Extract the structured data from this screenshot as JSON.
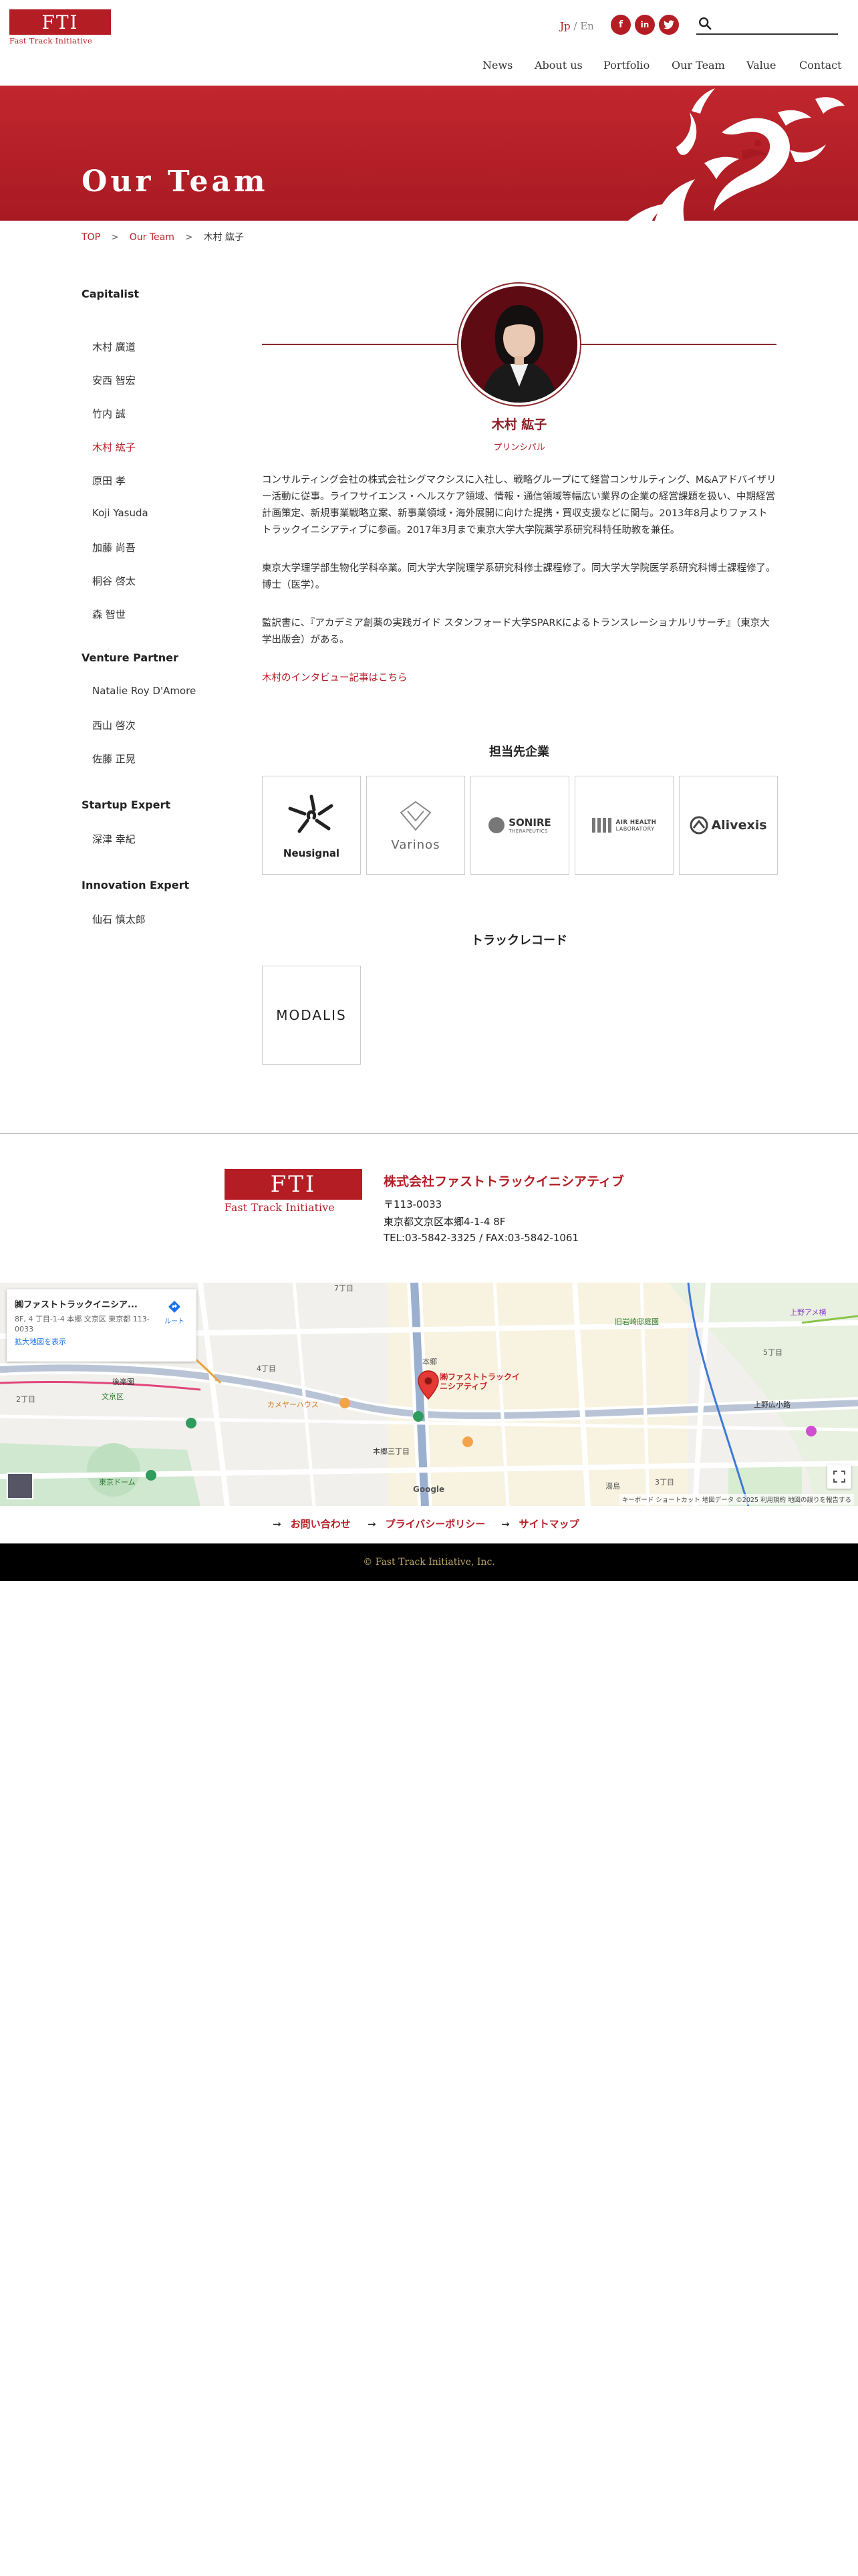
{
  "header": {
    "logo_main": "FTI",
    "logo_sub": "Fast Track Initiative",
    "lang_jp": "Jp",
    "lang_sep": " / ",
    "lang_en": "En",
    "social": {
      "facebook": "f",
      "linkedin": "in",
      "twitter": "t"
    },
    "search_placeholder": "",
    "nav": [
      "News",
      "About us",
      "Portfolio",
      "Our Team",
      "Value",
      "Contact"
    ]
  },
  "hero": {
    "title": "Our Team"
  },
  "breadcrumb": {
    "top": "TOP",
    "team": "Our Team",
    "current": "木村 紘子",
    "sep": ">"
  },
  "sidebar": {
    "sections": [
      {
        "heading": "Capitalist",
        "items": [
          "木村 廣道",
          "安西 智宏",
          "竹内 誠",
          "木村 紘子",
          "原田 孝",
          "Koji Yasuda",
          "加藤 尚吾",
          "桐谷 啓太",
          "森 智世"
        ]
      },
      {
        "heading": "Venture Partner",
        "items": [
          "Natalie Roy D'Amore",
          "西山 啓次",
          "佐藤 正晃"
        ]
      },
      {
        "heading": "Startup Expert",
        "items": [
          "深津 幸紀"
        ]
      },
      {
        "heading": "Innovation Expert",
        "items": [
          "仙石 慎太郎"
        ]
      }
    ]
  },
  "member": {
    "name": "木村 紘子",
    "role": "プリンシパル",
    "bio": [
      "コンサルティング会社の株式会社シグマクシスに入社し、戦略グループにて経営コンサルティング、M&Aアドバイザリー活動に従事。ライフサイエンス・ヘルスケア領域、情報・通信領域等幅広い業界の企業の経営課題を扱い、中期経営計画策定、新規事業戦略立案、新事業領域・海外展開に向けた提携・買収支援などに関与。2013年8月よりファストトラックイニシアティブに参画。2017年3月まで東京大学大学院薬学系研究科特任助教を兼任。",
      "東京大学理学部生物化学科卒業。同大学大学院理学系研究科修士課程修了。同大学大学院医学系研究科博士課程修了。博士（医学）。",
      "監訳書に、『アカデミア創薬の実践ガイド スタンフォード大学SPARKによるトランスレーショナルリサーチ』（東京大学出版会）がある。"
    ],
    "interview_link": "木村のインタビュー記事はこちら"
  },
  "portfolio": {
    "title": "担当先企業",
    "companies": [
      {
        "name": "Neusignal",
        "sub": ""
      },
      {
        "name": "Varinos",
        "sub": ""
      },
      {
        "name": "SONIRE",
        "sub": "THERAPEUTICS"
      },
      {
        "name": "AIR HEALTH",
        "sub": "LABORATORY"
      },
      {
        "name": "Alivexis",
        "sub": ""
      }
    ]
  },
  "track": {
    "title": "トラックレコード",
    "companies": [
      {
        "name": "MODALIS"
      }
    ]
  },
  "footer": {
    "logo_main": "FTI",
    "logo_sub": "Fast Track Initiative",
    "company": "株式会社ファストトラックイニシアティブ",
    "zip": "〒113-0033",
    "address": "東京都文京区本郷4-1-4 8F",
    "tel": "TEL:03-5842-3325 / FAX:03-5842-1061",
    "links": [
      "お問い合わせ",
      "プライバシーポリシー",
      "サイトマップ"
    ],
    "arrow": "→",
    "copyright": "© Fast Track Initiative, Inc."
  },
  "map": {
    "card_title": "㈱ファストトラックイニシア...",
    "card_address": "8F, 4 丁目-1-4 本郷 文京区 東京都 113-0033",
    "card_link": "拡大地図を表示",
    "route": "ルート",
    "pin_label": "㈱ファストトラックイニシアティブ",
    "attribution": "キーボード ショートカット 地図データ ©2025 利用規約 地図の誤りを報告する",
    "google": "Google",
    "labels": [
      "本郷",
      "本郷三丁目",
      "湯島",
      "上野広小路",
      "上野アメ横",
      "東京ドーム",
      "文京区",
      "後楽園",
      "旧岩崎邸庭園",
      "カメヤーハウス",
      "4丁目",
      "7丁目",
      "3丁目",
      "2丁目",
      "5丁目"
    ]
  },
  "colors": {
    "brand": "#b51d25",
    "dark_red": "#8a1d23"
  }
}
